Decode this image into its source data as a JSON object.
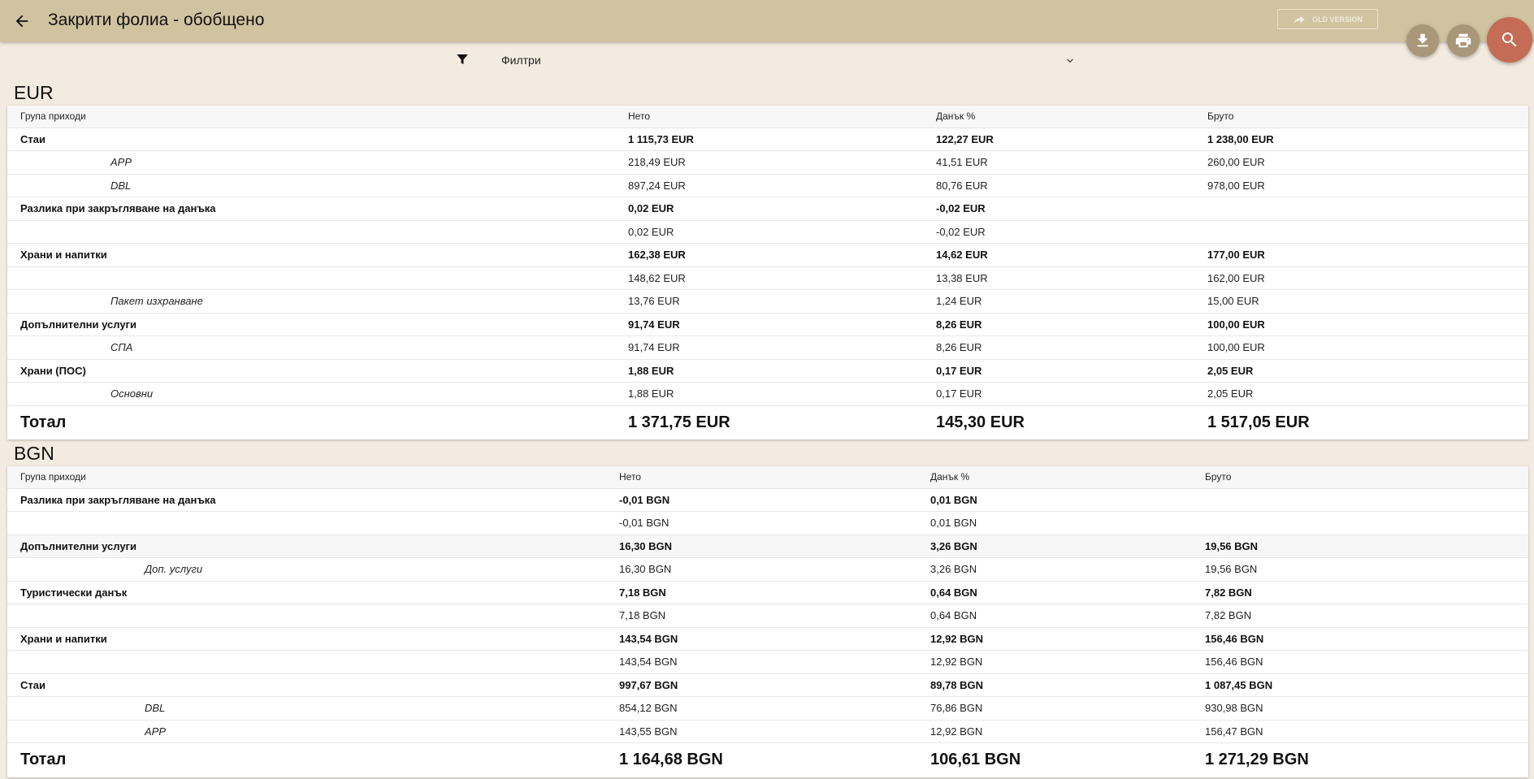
{
  "header": {
    "title": "Закрити фолиа - обобщено",
    "old_version_label": "OLD VERSION"
  },
  "filters": {
    "label": "Филтри"
  },
  "colors": {
    "topbar": "#d0c3a0",
    "background": "#f4ebe0",
    "search_fab": "#c46c55",
    "small_fab": "#a89778"
  },
  "icons": [
    "arrow-back-icon",
    "redirect-arrow-icon",
    "download-icon",
    "print-icon",
    "search-icon",
    "filter-icon",
    "chevron-down-icon"
  ],
  "eur": {
    "title": "EUR",
    "columns": [
      "Група приходи",
      "Нето",
      "Данък %",
      "Бруто"
    ],
    "rows": [
      {
        "type": "group",
        "name": "Стаи",
        "net": "1 115,73 EUR",
        "tax": "122,27 EUR",
        "gross": "1 238,00 EUR"
      },
      {
        "type": "sub",
        "name": "APP",
        "net": "218,49 EUR",
        "tax": "41,51 EUR",
        "gross": "260,00 EUR"
      },
      {
        "type": "sub",
        "name": "DBL",
        "net": "897,24 EUR",
        "tax": "80,76 EUR",
        "gross": "978,00 EUR"
      },
      {
        "type": "group",
        "name": "Разлика при закръгляване на данъка",
        "net": "0,02 EUR",
        "tax": "-0,02 EUR",
        "gross": ""
      },
      {
        "type": "sub",
        "name": "",
        "net": "0,02 EUR",
        "tax": "-0,02 EUR",
        "gross": ""
      },
      {
        "type": "group",
        "name": "Храни и напитки",
        "net": "162,38 EUR",
        "tax": "14,62 EUR",
        "gross": "177,00 EUR"
      },
      {
        "type": "sub",
        "name": "",
        "net": "148,62 EUR",
        "tax": "13,38 EUR",
        "gross": "162,00 EUR"
      },
      {
        "type": "sub",
        "name": "Пакет изхранване",
        "net": "13,76 EUR",
        "tax": "1,24 EUR",
        "gross": "15,00 EUR"
      },
      {
        "type": "group",
        "name": "Допълнителни услуги",
        "net": "91,74 EUR",
        "tax": "8,26 EUR",
        "gross": "100,00 EUR"
      },
      {
        "type": "sub",
        "name": "СПА",
        "net": "91,74 EUR",
        "tax": "8,26 EUR",
        "gross": "100,00 EUR"
      },
      {
        "type": "group",
        "name": "Храни (ПОС)",
        "net": "1,88 EUR",
        "tax": "0,17 EUR",
        "gross": "2,05 EUR"
      },
      {
        "type": "sub",
        "name": "Основни",
        "net": "1,88 EUR",
        "tax": "0,17 EUR",
        "gross": "2,05 EUR"
      }
    ],
    "total": {
      "label": "Тотал",
      "net": "1 371,75 EUR",
      "tax": "145,30 EUR",
      "gross": "1 517,05 EUR"
    }
  },
  "bgn": {
    "title": "BGN",
    "columns": [
      "Група приходи",
      "Нето",
      "Данък %",
      "Бруто"
    ],
    "rows": [
      {
        "type": "group",
        "name": "Разлика при закръгляване на данъка",
        "net": "-0,01 BGN",
        "tax": "0,01 BGN",
        "gross": ""
      },
      {
        "type": "sub",
        "name": "",
        "net": "-0,01 BGN",
        "tax": "0,01 BGN",
        "gross": ""
      },
      {
        "type": "group",
        "name": "Допълнителни услуги",
        "net": "16,30 BGN",
        "tax": "3,26 BGN",
        "gross": "19,56 BGN"
      },
      {
        "type": "sub",
        "name": "Доп. услуги",
        "net": "16,30 BGN",
        "tax": "3,26 BGN",
        "gross": "19,56 BGN"
      },
      {
        "type": "group",
        "name": "Туристически данък",
        "net": "7,18 BGN",
        "tax": "0,64 BGN",
        "gross": "7,82 BGN"
      },
      {
        "type": "sub",
        "name": "",
        "net": "7,18 BGN",
        "tax": "0,64 BGN",
        "gross": "7,82 BGN"
      },
      {
        "type": "group",
        "name": "Храни и напитки",
        "net": "143,54 BGN",
        "tax": "12,92 BGN",
        "gross": "156,46 BGN"
      },
      {
        "type": "sub",
        "name": "",
        "net": "143,54 BGN",
        "tax": "12,92 BGN",
        "gross": "156,46 BGN"
      },
      {
        "type": "group",
        "name": "Стаи",
        "net": "997,67 BGN",
        "tax": "89,78 BGN",
        "gross": "1 087,45 BGN"
      },
      {
        "type": "sub",
        "name": "DBL",
        "net": "854,12 BGN",
        "tax": "76,86 BGN",
        "gross": "930,98 BGN"
      },
      {
        "type": "sub",
        "name": "APP",
        "net": "143,55 BGN",
        "tax": "12,92 BGN",
        "gross": "156,47 BGN"
      }
    ],
    "total": {
      "label": "Тотал",
      "net": "1 164,68 BGN",
      "tax": "106,61 BGN",
      "gross": "1 271,29 BGN"
    }
  }
}
